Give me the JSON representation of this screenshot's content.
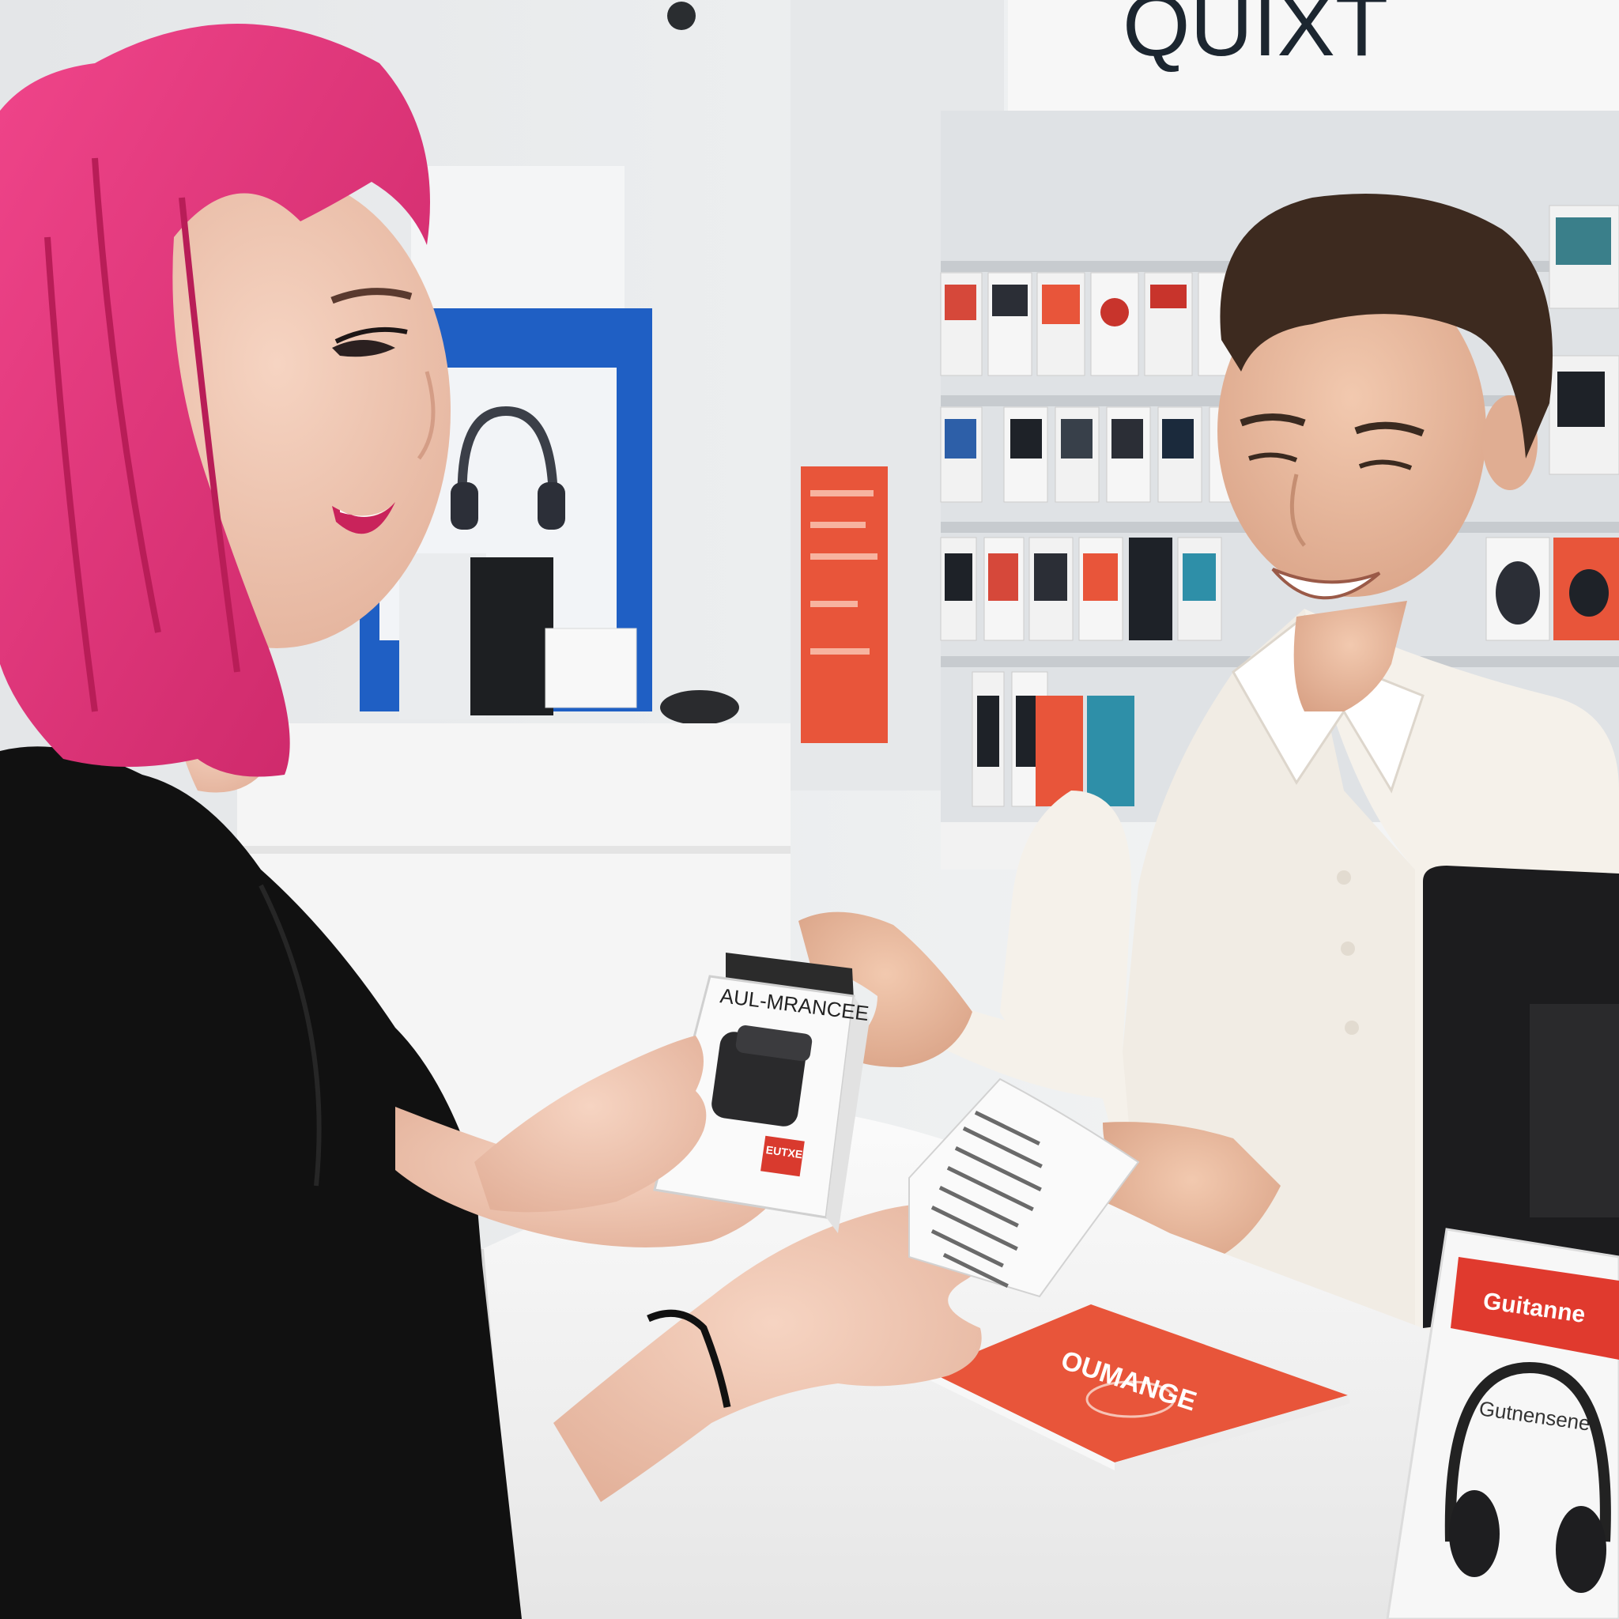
{
  "scene": {
    "store_sign": "QUIXT",
    "charger_box": {
      "title": "AUL-MRANCEE",
      "sticker": "EUTXE"
    },
    "receipt": {
      "header": ""
    },
    "counter_booklet": {
      "title": "OUMANGE"
    },
    "headphone_display": {
      "title": "Guitanne",
      "subtitle": "Gutnensene"
    },
    "colors": {
      "hair": "#e8397a",
      "shirt_black": "#111111",
      "shirt_white": "#f5f1ea",
      "wall": "#eceef0",
      "accent_orange": "#e8553a",
      "accent_blue": "#1f5fc4",
      "counter": "#f4f4f4"
    }
  }
}
